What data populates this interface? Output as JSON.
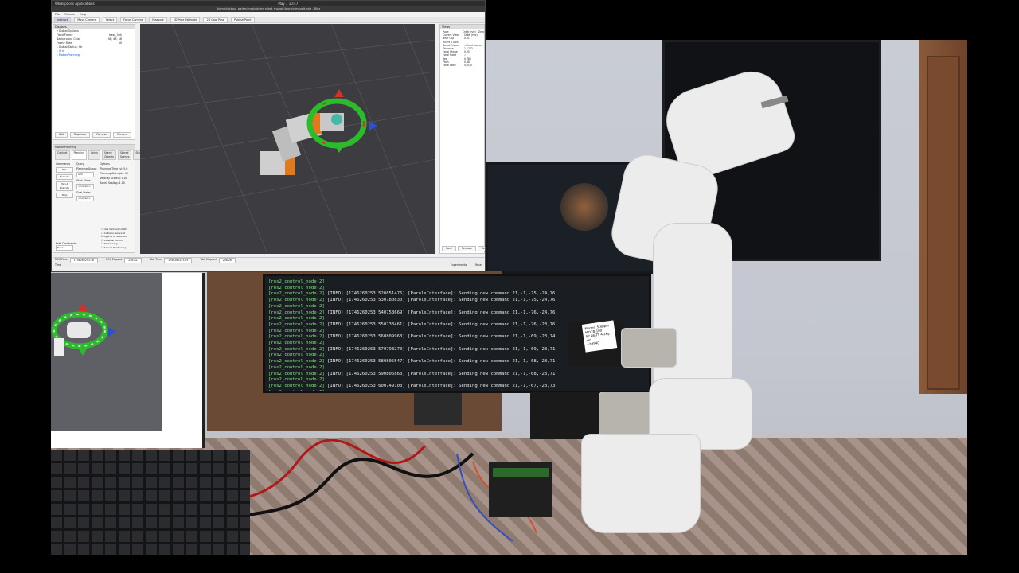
{
  "os_bar": {
    "left": "Workspaces   Applications",
    "center": "May 1  10:47",
    "right": ""
  },
  "window": {
    "title": "/home/pictopr_ws/src/mrobot/my_robot_moveit/launch/moveit.rviz - RViz"
  },
  "menus": [
    "File",
    "Panels",
    "Help"
  ],
  "toolbar": {
    "items": [
      "Interact",
      "Move Camera",
      "Select",
      "Focus Camera",
      "Measure",
      "2D Pose Estimate",
      "2D Goal Pose",
      "Publish Point"
    ],
    "active": "Interact"
  },
  "displays": {
    "header": "Displays",
    "rows": [
      {
        "label": "▾ Global Options",
        "value": ""
      },
      {
        "label": "Fixed Frame",
        "value": "base_link"
      },
      {
        "label": "Background Color",
        "value": "48; 48; 48"
      },
      {
        "label": "Frame Rate",
        "value": "30"
      },
      {
        "label": "▸ Global Status: Ok",
        "value": ""
      },
      {
        "label": "▸ Grid",
        "value": ""
      },
      {
        "label": "▸ MotionPlanning",
        "value": ""
      }
    ],
    "buttons": [
      "Add",
      "Duplicate",
      "Remove",
      "Rename"
    ]
  },
  "motion_planning": {
    "header": "MotionPlanning",
    "tabs": [
      "Context",
      "Planning",
      "Joints",
      "Scene Objects",
      "Stored Scenes",
      "Status"
    ],
    "active_tab": "Planning",
    "commands_label": "Commands",
    "query_label": "Query",
    "options_label": "Options",
    "buttons": [
      "Plan",
      "Execute",
      "Plan & Execute",
      "Stop"
    ],
    "planning_group_label": "Planning Group:",
    "planning_group": "arm",
    "start_state_label": "Start State:",
    "start_state": "<current>",
    "goal_state_label": "Goal State:",
    "goal_state": "<current>",
    "planning_time_label": "Planning Time (s):",
    "planning_time": "5.0",
    "attempts_label": "Planning Attempts:",
    "attempts": "10",
    "velocity_label": "Velocity Scaling:",
    "velocity": "1.00",
    "accel_label": "Accel. Scaling:",
    "accel": "1.00",
    "checks": [
      "Use Cartesian Path",
      "Collision-aware IK",
      "Approx IK Solutions",
      "External Comm.",
      "Replanning",
      "Sensor Positioning"
    ],
    "path_constraints_label": "Path Constraints:",
    "path_constraints": "None"
  },
  "views": {
    "header": "Views",
    "type_label": "Type:",
    "type_value": "Orbit (rviz)",
    "zero_button": "Zero",
    "rows": [
      {
        "k": "Current View",
        "v": "Orbit (rviz)"
      },
      {
        "k": "Near Clip",
        "v": "0.01"
      },
      {
        "k": "Invert Z Axis",
        "v": ""
      },
      {
        "k": "Target Frame",
        "v": "<Fixed Frame>"
      },
      {
        "k": "Distance",
        "v": "1.1742"
      },
      {
        "k": "Focal Shape",
        "v": "0.05"
      },
      {
        "k": "Focal Fixed",
        "v": "✓"
      },
      {
        "k": "Yaw",
        "v": "0.785"
      },
      {
        "k": "Pitch",
        "v": "0.48"
      },
      {
        "k": "Focal Point",
        "v": "0; 0; 0"
      }
    ],
    "buttons": [
      "Save",
      "Remove",
      "Rename"
    ]
  },
  "time": {
    "header": "Time",
    "fields": [
      {
        "label": "ROS Time:",
        "value": "1746260253.76"
      },
      {
        "label": "ROS Elapsed:",
        "value": "258.82"
      },
      {
        "label": "Wall Time:",
        "value": "1746260253.79"
      },
      {
        "label": "Wall Elapsed:",
        "value": "258.26"
      }
    ],
    "experimental": "Experimental",
    "reset": "Reset"
  },
  "terminal": {
    "lines": [
      {
        "node": "[ros2_control_node-2]",
        "text": ""
      },
      {
        "node": "[ros2_control_node-2]",
        "text": ""
      },
      {
        "node": "[ros2_control_node-2]",
        "text": " [INFO] [1746260253.520851476] [ParolsInterface]: Sending new command 21,-1,-75,-24,76"
      },
      {
        "node": "[ros2_control_node-2]",
        "text": " [INFO] [1746260253.530780830] [ParolsInterface]: Sending new command 21,-1,-75,-24,76"
      },
      {
        "node": "[ros2_control_node-2]",
        "text": ""
      },
      {
        "node": "[ros2_control_node-2]",
        "text": " [INFO] [1746260253.540758669] [ParolsInterface]: Sending new command 21,-1,-76,-24,76"
      },
      {
        "node": "[ros2_control_node-2]",
        "text": ""
      },
      {
        "node": "[ros2_control_node-2]",
        "text": " [INFO] [1746260253.550733461] [ParolsInterface]: Sending new command 21,-1,-76,-23,76"
      },
      {
        "node": "[ros2_control_node-2]",
        "text": ""
      },
      {
        "node": "[ros2_control_node-2]",
        "text": " [INFO] [1746260253.560809963] [ParolsInterface]: Sending new command 21,-1,-69,-23,74"
      },
      {
        "node": "[ros2_control_node-2]",
        "text": ""
      },
      {
        "node": "[ros2_control_node-2]",
        "text": " [INFO] [1746260253.570793270] [ParolsInterface]: Sending new command 21,-1,-69,-23,71"
      },
      {
        "node": "[ros2_control_node-2]",
        "text": ""
      },
      {
        "node": "[ros2_control_node-2]",
        "text": " [INFO] [1746260253.580805547] [ParolsInterface]: Sending new command 21,-1,-68,-23,71"
      },
      {
        "node": "[ros2_control_node-2]",
        "text": ""
      },
      {
        "node": "[ros2_control_node-2]",
        "text": " [INFO] [1746260253.590805863] [ParolsInterface]: Sending new command 21,-1,-68,-23,71"
      },
      {
        "node": "[ros2_control_node-2]",
        "text": ""
      },
      {
        "node": "[ros2_control_node-2]",
        "text": " [INFO] [1746260253.600749103] [ParolsInterface]: Sending new command 21,-1,-67,-23,73"
      },
      {
        "node": "[ros2_control_node-2]",
        "text": ""
      },
      {
        "node": "[ros2_control_node-2]",
        "text": " [INFO] [1746260253.610859625] [ParolsInterface]: Sending new command 21,-1,-67,-23,73"
      },
      {
        "node": "[ros2_control_node-2]",
        "text": ""
      }
    ]
  },
  "motor_label": {
    "brand": "Moons' Stepper",
    "model": "MOCB-1007",
    "spec": "57 WATT 4.2kg cm",
    "part": "42H540"
  },
  "colors": {
    "viewport_bg": "#3c3c41",
    "robot_orange": "#e07a1f",
    "marker_green": "#2bbb2b",
    "marker_red": "#d6302b",
    "marker_blue": "#2d4fd0",
    "terminal_green": "#7ee07e"
  }
}
